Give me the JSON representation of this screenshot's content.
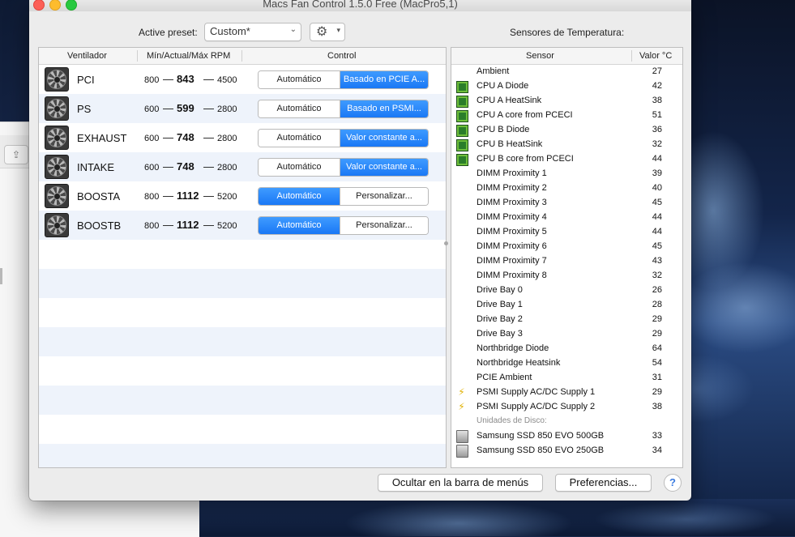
{
  "window": {
    "title": "Macs Fan Control 1.5.0 Free (MacPro5,1)"
  },
  "preset": {
    "label": "Active preset:",
    "value": "Custom*"
  },
  "sensors_title": "Sensores de Temperatura:",
  "fans": {
    "headers": {
      "fan": "Ventilador",
      "rpm": "Mín/Actual/Máx RPM",
      "control": "Control"
    },
    "rows": [
      {
        "name": "PCI",
        "min": "800",
        "cur": "843",
        "max": "4500",
        "auto": "Automático",
        "custom": "Basado en PCIE A...",
        "mode": "custom"
      },
      {
        "name": "PS",
        "min": "600",
        "cur": "599",
        "max": "2800",
        "auto": "Automático",
        "custom": "Basado en PSMI...",
        "mode": "custom"
      },
      {
        "name": "EXHAUST",
        "min": "600",
        "cur": "748",
        "max": "2800",
        "auto": "Automático",
        "custom": "Valor constante a...",
        "mode": "custom"
      },
      {
        "name": "INTAKE",
        "min": "600",
        "cur": "748",
        "max": "2800",
        "auto": "Automático",
        "custom": "Valor constante a...",
        "mode": "custom"
      },
      {
        "name": "BOOSTA",
        "min": "800",
        "cur": "1112",
        "max": "5200",
        "auto": "Automático",
        "custom": "Personalizar...",
        "mode": "auto"
      },
      {
        "name": "BOOSTB",
        "min": "800",
        "cur": "1112",
        "max": "5200",
        "auto": "Automático",
        "custom": "Personalizar...",
        "mode": "auto"
      }
    ]
  },
  "sensors": {
    "headers": {
      "sensor": "Sensor",
      "value": "Valor °C"
    },
    "rows": [
      {
        "name": "Ambient",
        "value": "27",
        "icon": "none"
      },
      {
        "name": "CPU A Diode",
        "value": "42",
        "icon": "chip-icon"
      },
      {
        "name": "CPU A HeatSink",
        "value": "38",
        "icon": "chip-icon"
      },
      {
        "name": "CPU A core from PCECI",
        "value": "51",
        "icon": "chip-icon"
      },
      {
        "name": "CPU B Diode",
        "value": "36",
        "icon": "chip-icon"
      },
      {
        "name": "CPU B HeatSink",
        "value": "32",
        "icon": "chip-icon"
      },
      {
        "name": "CPU B core from PCECI",
        "value": "44",
        "icon": "chip-icon"
      },
      {
        "name": "DIMM Proximity 1",
        "value": "39",
        "icon": "none"
      },
      {
        "name": "DIMM Proximity 2",
        "value": "40",
        "icon": "none"
      },
      {
        "name": "DIMM Proximity 3",
        "value": "45",
        "icon": "none"
      },
      {
        "name": "DIMM Proximity 4",
        "value": "44",
        "icon": "none"
      },
      {
        "name": "DIMM Proximity 5",
        "value": "44",
        "icon": "none"
      },
      {
        "name": "DIMM Proximity 6",
        "value": "45",
        "icon": "none"
      },
      {
        "name": "DIMM Proximity 7",
        "value": "43",
        "icon": "none"
      },
      {
        "name": "DIMM Proximity 8",
        "value": "32",
        "icon": "none"
      },
      {
        "name": "Drive Bay 0",
        "value": "26",
        "icon": "none"
      },
      {
        "name": "Drive Bay 1",
        "value": "28",
        "icon": "none"
      },
      {
        "name": "Drive Bay 2",
        "value": "29",
        "icon": "none"
      },
      {
        "name": "Drive Bay 3",
        "value": "29",
        "icon": "none"
      },
      {
        "name": "Northbridge Diode",
        "value": "64",
        "icon": "none"
      },
      {
        "name": "Northbridge Heatsink",
        "value": "54",
        "icon": "none"
      },
      {
        "name": "PCIE Ambient",
        "value": "31",
        "icon": "none"
      },
      {
        "name": "PSMI Supply AC/DC Supply 1",
        "value": "29",
        "icon": "bolt-icon"
      },
      {
        "name": "PSMI Supply AC/DC Supply 2",
        "value": "38",
        "icon": "bolt-icon"
      },
      {
        "section": "Unidades de Disco:"
      },
      {
        "name": "Samsung SSD 850 EVO 500GB",
        "value": "33",
        "icon": "disk-icon"
      },
      {
        "name": "Samsung SSD 850 EVO 250GB",
        "value": "34",
        "icon": "disk-icon"
      }
    ]
  },
  "buttons": {
    "hide": "Ocultar en la barra de menús",
    "prefs": "Preferencias...",
    "help": "?"
  },
  "colors": {
    "accent": "#1a78f5",
    "stripe": "#eef3fb"
  }
}
